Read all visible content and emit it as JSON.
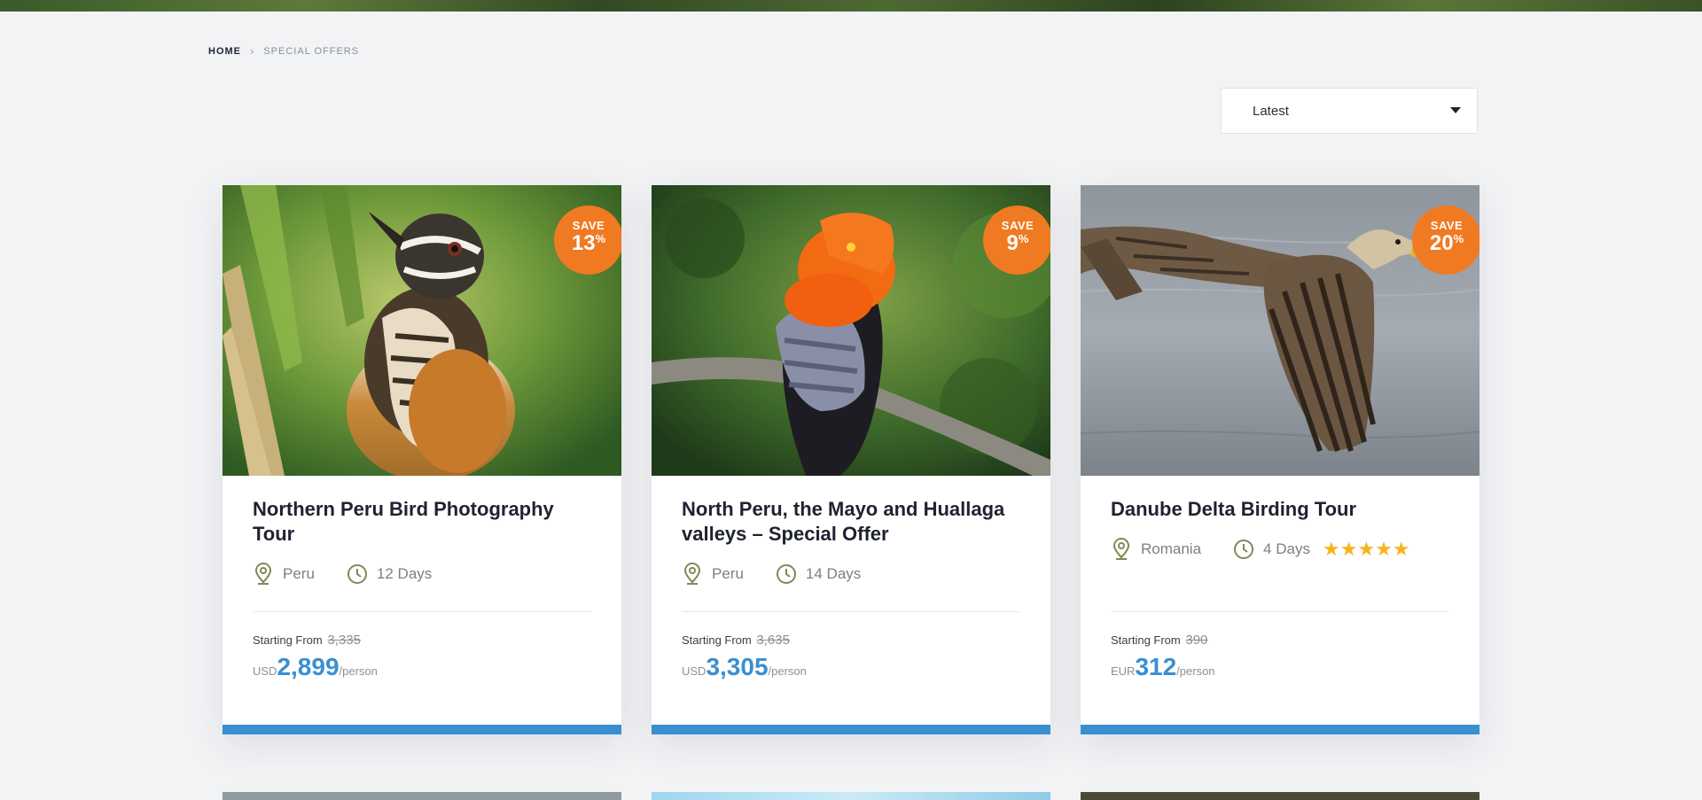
{
  "breadcrumb": {
    "home": "HOME",
    "separator": "›",
    "current": "SPECIAL OFFERS"
  },
  "sort": {
    "selected": "Latest"
  },
  "colors": {
    "accent": "#3a8fd1",
    "badge": "#f07a22",
    "star": "#f5b418"
  },
  "cards": [
    {
      "title": "Northern Peru Bird Photography Tour",
      "save_label": "SAVE",
      "save_value": "13",
      "save_unit": "%",
      "location": "Peru",
      "duration": "12 Days",
      "starting_label": "Starting From",
      "old_price": "3,335",
      "currency": "USD",
      "price": "2,899",
      "per": "/person",
      "rating": 0
    },
    {
      "title": "North Peru, the Mayo and Huallaga valleys – Special Offer",
      "save_label": "SAVE",
      "save_value": "9",
      "save_unit": "%",
      "location": "Peru",
      "duration": "14 Days",
      "starting_label": "Starting From",
      "old_price": "3,635",
      "currency": "USD",
      "price": "3,305",
      "per": "/person",
      "rating": 0
    },
    {
      "title": "Danube Delta Birding Tour",
      "save_label": "SAVE",
      "save_value": "20",
      "save_unit": "%",
      "location": "Romania",
      "duration": "4 Days",
      "starting_label": "Starting From",
      "old_price": "390",
      "currency": "EUR",
      "price": "312",
      "per": "/person",
      "rating": 5
    }
  ],
  "icons": {
    "location": "map-pin-icon",
    "duration": "clock-icon",
    "rating": "star-icon",
    "dropdown": "caret-down-icon",
    "breadcrumb_sep": "chevron-right-icon"
  }
}
